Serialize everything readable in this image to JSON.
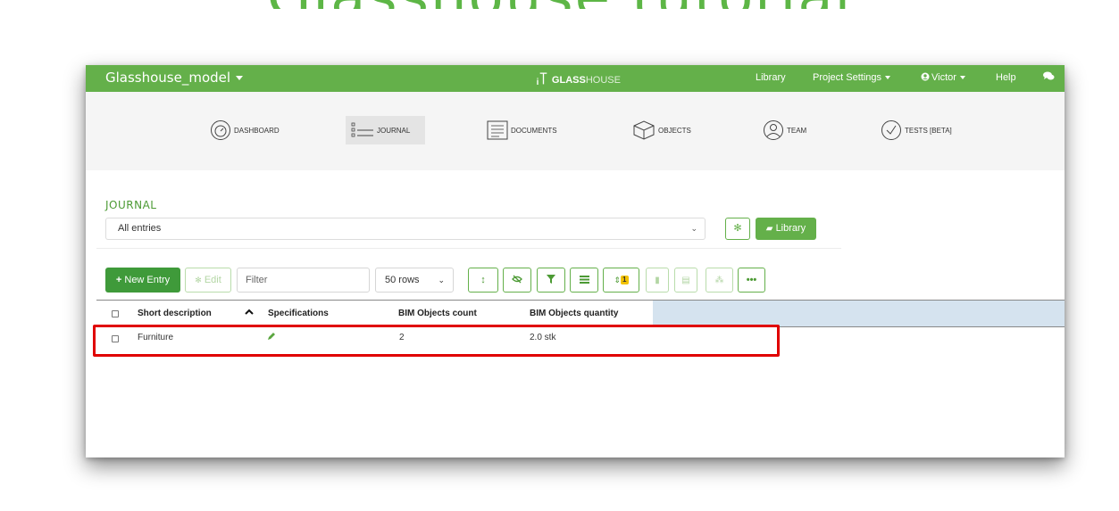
{
  "headline": "Glasshouse tutorial",
  "navbar": {
    "project_name": "Glasshouse_model",
    "brand_bold": "GLASS",
    "brand_light": "HOUSE",
    "library": "Library",
    "project_settings": "Project Settings",
    "user": "Victor",
    "help": "Help"
  },
  "tabs": [
    {
      "label": "DASHBOARD",
      "icon": "dashboard-gauge-icon"
    },
    {
      "label": "JOURNAL",
      "icon": "journal-list-icon"
    },
    {
      "label": "DOCUMENTS",
      "icon": "document-icon"
    },
    {
      "label": "OBJECTS",
      "icon": "cube-icon"
    },
    {
      "label": "TEAM",
      "icon": "user-icon"
    },
    {
      "label": "TESTS [BETA]",
      "icon": "checkmark-circle-icon"
    }
  ],
  "journal": {
    "title": "JOURNAL",
    "selected_view": "All entries",
    "library_button": "Library"
  },
  "toolbar": {
    "new_entry": "New Entry",
    "edit": "Edit",
    "filter_placeholder": "Filter",
    "rows": "50 rows",
    "sort_badge": "1"
  },
  "table": {
    "columns": [
      "Short description",
      "Specifications",
      "BIM Objects count",
      "BIM Objects quantity"
    ],
    "rows": [
      {
        "short_description": "Furniture",
        "bim_objects_count": "2",
        "bim_objects_quantity": "2.0 stk"
      }
    ]
  },
  "colors": {
    "brand_green": "#64b04a",
    "highlight_red": "#e00000",
    "header_fill": "#d5e3ef"
  }
}
